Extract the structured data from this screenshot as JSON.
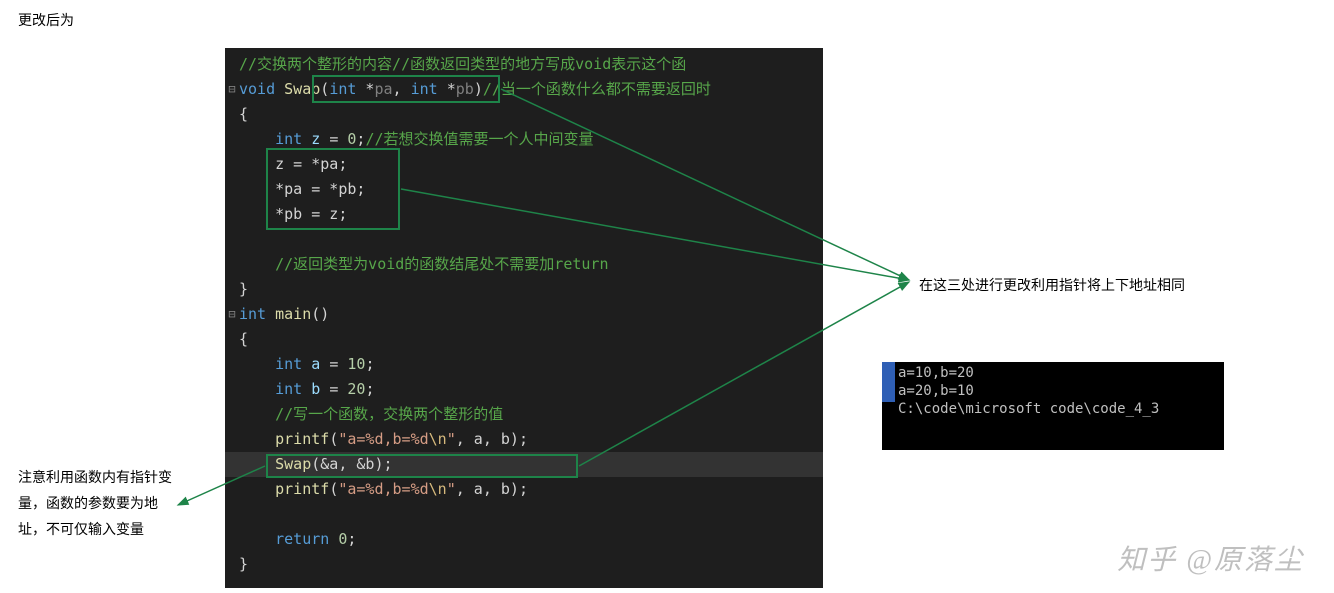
{
  "top_label": "更改后为",
  "code": {
    "l1_comment": "//交换两个整形的内容//函数返回类型的地方写成void表示这个函",
    "l2_kw_void": "void",
    "l2_func": "Swap",
    "l2_sig_open": "(",
    "l2_type_int1": "int",
    "l2_star1": " *",
    "l2_pa": "pa",
    "l2_comma": ", ",
    "l2_type_int2": "int",
    "l2_star2": " *",
    "l2_pb": "pb",
    "l2_sig_close": ")",
    "l2_comment": "//当一个函数什么都不需要返回时",
    "l3_brace": "{",
    "l4_indent": "    ",
    "l4_type": "int",
    "l4_var": " z ",
    "l4_eq": "= ",
    "l4_num": "0",
    "l4_semi": ";",
    "l4_comment": "//若想交换值需要一个人中间变量",
    "l5_indent": "    ",
    "l5_text": "z = *pa;",
    "l6_indent": "    ",
    "l6_text": "*pa = *pb;",
    "l7_indent": "    ",
    "l7_text": "*pb = z;",
    "l8_blank": "",
    "l9_indent": "    ",
    "l9_comment": "//返回类型为void的函数结尾处不需要加return",
    "l10_brace": "}",
    "l11_type": "int",
    "l11_func": " main",
    "l11_paren": "()",
    "l12_brace": "{",
    "l13_indent": "    ",
    "l13_type": "int",
    "l13_var": " a ",
    "l13_eq": "= ",
    "l13_num": "10",
    "l13_semi": ";",
    "l14_indent": "    ",
    "l14_type": "int",
    "l14_var": " b ",
    "l14_eq": "= ",
    "l14_num": "20",
    "l14_semi": ";",
    "l15_indent": "    ",
    "l15_comment": "//写一个函数，交换两个整形的值",
    "l16_indent": "    ",
    "l16_func": "printf",
    "l16_open": "(",
    "l16_q1": "\"",
    "l16_fmt": "a=%d,b=%d",
    "l16_esc": "\\n",
    "l16_q2": "\"",
    "l16_args": ", a, b);",
    "l17_indent": "    ",
    "l17_func": "Swap",
    "l17_args": "(&a, &b);",
    "l18_indent": "    ",
    "l18_func": "printf",
    "l18_open": "(",
    "l18_q1": "\"",
    "l18_fmt": "a=%d,b=%d",
    "l18_esc": "\\n",
    "l18_q2": "\"",
    "l18_args": ", a, b);",
    "l19_blank": "",
    "l20_indent": "    ",
    "l20_kw": "return",
    "l20_sp": " ",
    "l20_num": "0",
    "l20_semi": ";",
    "l21_brace": "}"
  },
  "terminal": {
    "t1": "a=10,b=20",
    "t2": "a=20,b=10",
    "t3": "",
    "t4": "C:\\code\\microsoft code\\code_4_3"
  },
  "annot_right": "在这三处进行更改利用指针将上下地址相同",
  "annot_left": "注意利用函数内有指针变量，函数的参数要为地址，不可仅输入变量",
  "watermark": "知乎 @原落尘"
}
